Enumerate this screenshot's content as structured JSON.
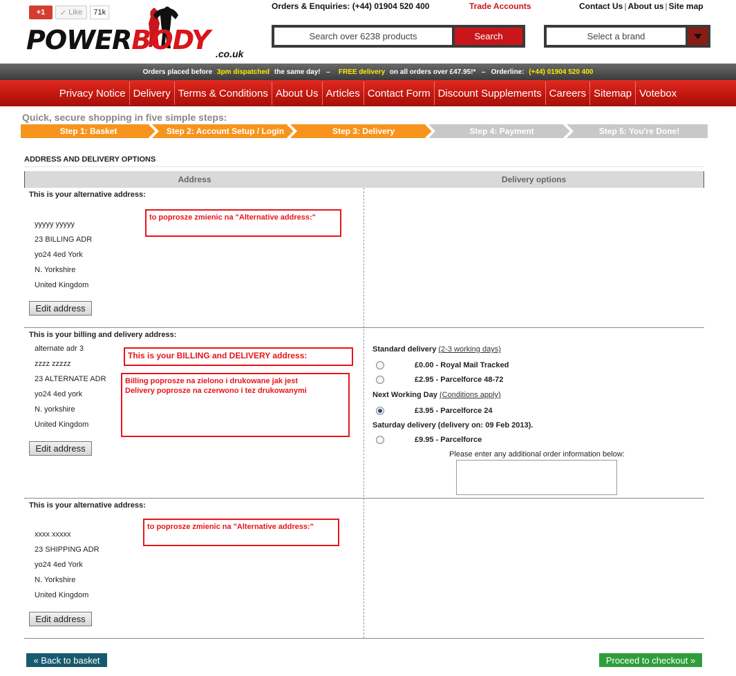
{
  "social": {
    "gplus": "+1",
    "like": "Like",
    "like_count": "71k"
  },
  "logo": {
    "power": "POWER",
    "body": "BODY",
    "suffix": ".co.uk"
  },
  "header": {
    "enquiries": "Orders & Enquiries: (+44) 01904 520 400",
    "trade": "Trade Accounts",
    "links": [
      "Contact Us",
      "About us",
      "Site map"
    ],
    "search_placeholder": "Search over 6238 products",
    "search_button": "Search",
    "brand_placeholder": "Select a brand"
  },
  "promo": {
    "p1": "Orders placed before ",
    "p2": "3pm dispatched",
    "p3": " the same day!   –   ",
    "p4": "FREE delivery",
    "p5": " on all orders over £47.95!*   –   Orderline: ",
    "p6": "(+44) 01904 520 400"
  },
  "nav": [
    "Privacy Notice",
    "Delivery",
    "Terms & Conditions",
    "About Us",
    "Articles",
    "Contact Form",
    "Discount Supplements",
    "Careers",
    "Sitemap",
    "Votebox"
  ],
  "steps_intro": "Quick, secure shopping in five simple steps:",
  "steps": [
    "Step 1: Basket",
    "Step 2: Account Setup / Login",
    "Step 3: Delivery",
    "Step 4: Payment",
    "Step 5: You're Done!"
  ],
  "section_title": "ADDRESS AND DELIVERY OPTIONS",
  "columns": {
    "address": "Address",
    "delivery": "Delivery options"
  },
  "blocks": [
    {
      "title": "This is your alternative address:",
      "lines": [
        "yyyyy yyyyy",
        "23 BILLING ADR",
        "yo24 4ed York",
        "N. Yorkshire",
        "United Kingdom"
      ],
      "edit": "Edit address",
      "note": "to poprosze zmienic na \"Alternative address:\""
    },
    {
      "title": "This is your billing and delivery address:",
      "lines": [
        "alternate adr 3",
        "zzzz zzzzz",
        "23 ALTERNATE ADR",
        "yo24 4ed york",
        "N. yorkshire",
        "United Kingdom"
      ],
      "edit": "Edit address",
      "note1": "This is your BILLING and DELIVERY address:",
      "note2a": "Billing poprosze na zielono i drukowane jak jest",
      "note2b": "Delivery poprosze na czerwono i tez drukowanymi"
    },
    {
      "title": "This is your alternative address:",
      "lines": [
        "xxxx xxxxx",
        "23 SHIPPING ADR",
        "yo24 4ed York",
        "N. Yorkshire",
        "United Kingdom"
      ],
      "edit": "Edit address",
      "note": "to poprosze zmienic na \"Alternative address:\""
    }
  ],
  "delivery": {
    "standard": "Standard delivery",
    "standard_link": "(2-3 working days)",
    "opt1": "£0.00 - Royal Mail Tracked",
    "opt2": "£2.95 - Parcelforce 48-72",
    "nextday": "Next Working Day",
    "nextday_link": "(Conditions apply)",
    "opt3": "£3.95 - Parcelforce 24",
    "saturday": "Saturday delivery (delivery on: 09 Feb 2013).",
    "opt4": "£9.95 - Parcelforce",
    "selected": "£3.95 - Parcelforce 24",
    "extra_label": "Please enter any additional order information below:"
  },
  "buttons": {
    "back": "« Back to basket",
    "proceed": "Proceed to checkout »"
  },
  "colors": {
    "brand_red": "#c8161b",
    "step_active": "#f7941d",
    "step_inactive": "#c8c8c8",
    "proceed_green": "#2e9e3a",
    "back_teal": "#175a6e",
    "note_red": "#e8141b"
  }
}
